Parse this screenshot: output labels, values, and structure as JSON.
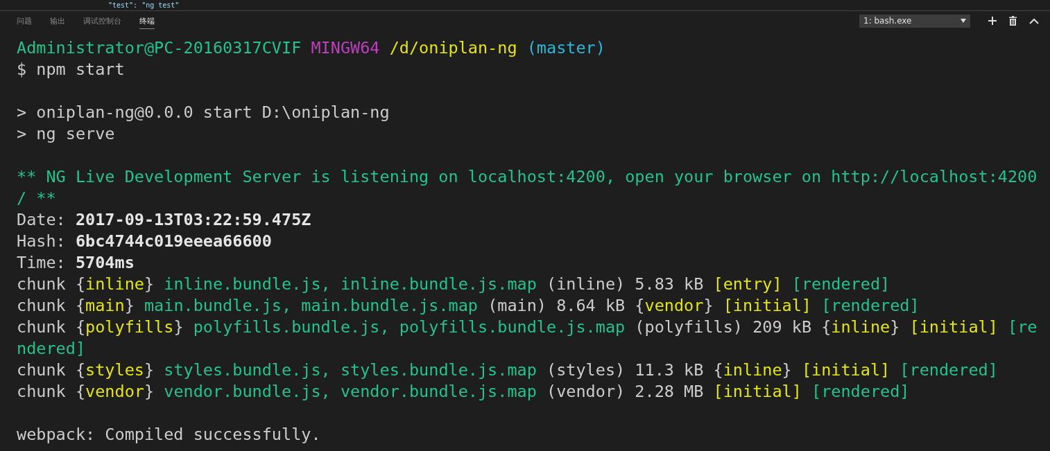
{
  "editor_peek": {
    "code": "\"test\": \"ng test\""
  },
  "panel": {
    "tabs": [
      {
        "label": "问题",
        "selected": false
      },
      {
        "label": "输出",
        "selected": false
      },
      {
        "label": "调试控制台",
        "selected": false
      },
      {
        "label": "终端",
        "selected": true
      }
    ],
    "terminal_select": {
      "value": "1: bash.exe"
    }
  },
  "terminal": {
    "blocks": [
      {
        "lines": [
          [
            {
              "text": "Administrator@PC-20160317CVIF ",
              "kind": "green"
            },
            {
              "text": "MINGW64 ",
              "kind": "magenta"
            },
            {
              "text": "/d/oniplan-ng ",
              "kind": "yellow"
            },
            {
              "text": "(master)",
              "kind": "cyan"
            }
          ],
          [
            {
              "text": "$ npm start",
              "kind": "plain"
            }
          ]
        ]
      },
      {
        "lines": [
          [
            {
              "text": "> oniplan-ng@0.0.0 start D:\\oniplan-ng",
              "kind": "plain"
            }
          ],
          [
            {
              "text": "> ng serve",
              "kind": "plain"
            }
          ]
        ]
      },
      {
        "lines": [
          [
            {
              "text": "** NG Live Development Server is listening on localhost:4200, open your browser on http://localhost:4200",
              "kind": "green"
            }
          ],
          [
            {
              "text": "/ **",
              "kind": "green"
            }
          ],
          [
            {
              "text": "Date: ",
              "kind": "plain"
            },
            {
              "text": "2017-09-13T03:22:59.475Z",
              "kind": "bold"
            }
          ],
          [
            {
              "text": "Hash: ",
              "kind": "plain"
            },
            {
              "text": "6bc4744c019eeea66600",
              "kind": "bold"
            }
          ],
          [
            {
              "text": "Time: ",
              "kind": "plain"
            },
            {
              "text": "5704ms",
              "kind": "bold"
            }
          ],
          [
            {
              "text": "chunk {",
              "kind": "plain"
            },
            {
              "text": "inline",
              "kind": "yellow"
            },
            {
              "text": "} ",
              "kind": "plain"
            },
            {
              "text": "inline.bundle.js, inline.bundle.js.map ",
              "kind": "green"
            },
            {
              "text": "(inline) 5.83 kB ",
              "kind": "plain"
            },
            {
              "text": "[entry] ",
              "kind": "yellow"
            },
            {
              "text": "[rendered]",
              "kind": "green"
            }
          ],
          [
            {
              "text": "chunk {",
              "kind": "plain"
            },
            {
              "text": "main",
              "kind": "yellow"
            },
            {
              "text": "} ",
              "kind": "plain"
            },
            {
              "text": "main.bundle.js, main.bundle.js.map ",
              "kind": "green"
            },
            {
              "text": "(main) 8.64 kB {",
              "kind": "plain"
            },
            {
              "text": "vendor",
              "kind": "yellow"
            },
            {
              "text": "} ",
              "kind": "plain"
            },
            {
              "text": "[initial] ",
              "kind": "yellow"
            },
            {
              "text": "[rendered]",
              "kind": "green"
            }
          ],
          [
            {
              "text": "chunk {",
              "kind": "plain"
            },
            {
              "text": "polyfills",
              "kind": "yellow"
            },
            {
              "text": "} ",
              "kind": "plain"
            },
            {
              "text": "polyfills.bundle.js, polyfills.bundle.js.map ",
              "kind": "green"
            },
            {
              "text": "(polyfills) 209 kB {",
              "kind": "plain"
            },
            {
              "text": "inline",
              "kind": "yellow"
            },
            {
              "text": "} ",
              "kind": "plain"
            },
            {
              "text": "[initial] ",
              "kind": "yellow"
            },
            {
              "text": "[re",
              "kind": "green"
            }
          ],
          [
            {
              "text": "ndered]",
              "kind": "green"
            }
          ],
          [
            {
              "text": "chunk {",
              "kind": "plain"
            },
            {
              "text": "styles",
              "kind": "yellow"
            },
            {
              "text": "} ",
              "kind": "plain"
            },
            {
              "text": "styles.bundle.js, styles.bundle.js.map ",
              "kind": "green"
            },
            {
              "text": "(styles) 11.3 kB {",
              "kind": "plain"
            },
            {
              "text": "inline",
              "kind": "yellow"
            },
            {
              "text": "} ",
              "kind": "plain"
            },
            {
              "text": "[initial] ",
              "kind": "yellow"
            },
            {
              "text": "[rendered]",
              "kind": "green"
            }
          ],
          [
            {
              "text": "chunk {",
              "kind": "plain"
            },
            {
              "text": "vendor",
              "kind": "yellow"
            },
            {
              "text": "} ",
              "kind": "plain"
            },
            {
              "text": "vendor.bundle.js, vendor.bundle.js.map ",
              "kind": "green"
            },
            {
              "text": "(vendor) 2.28 MB ",
              "kind": "plain"
            },
            {
              "text": "[initial] ",
              "kind": "yellow"
            },
            {
              "text": "[rendered]",
              "kind": "green"
            }
          ]
        ]
      },
      {
        "lines": [
          [
            {
              "text": "webpack: Compiled successfully.",
              "kind": "plain"
            }
          ]
        ]
      }
    ]
  }
}
